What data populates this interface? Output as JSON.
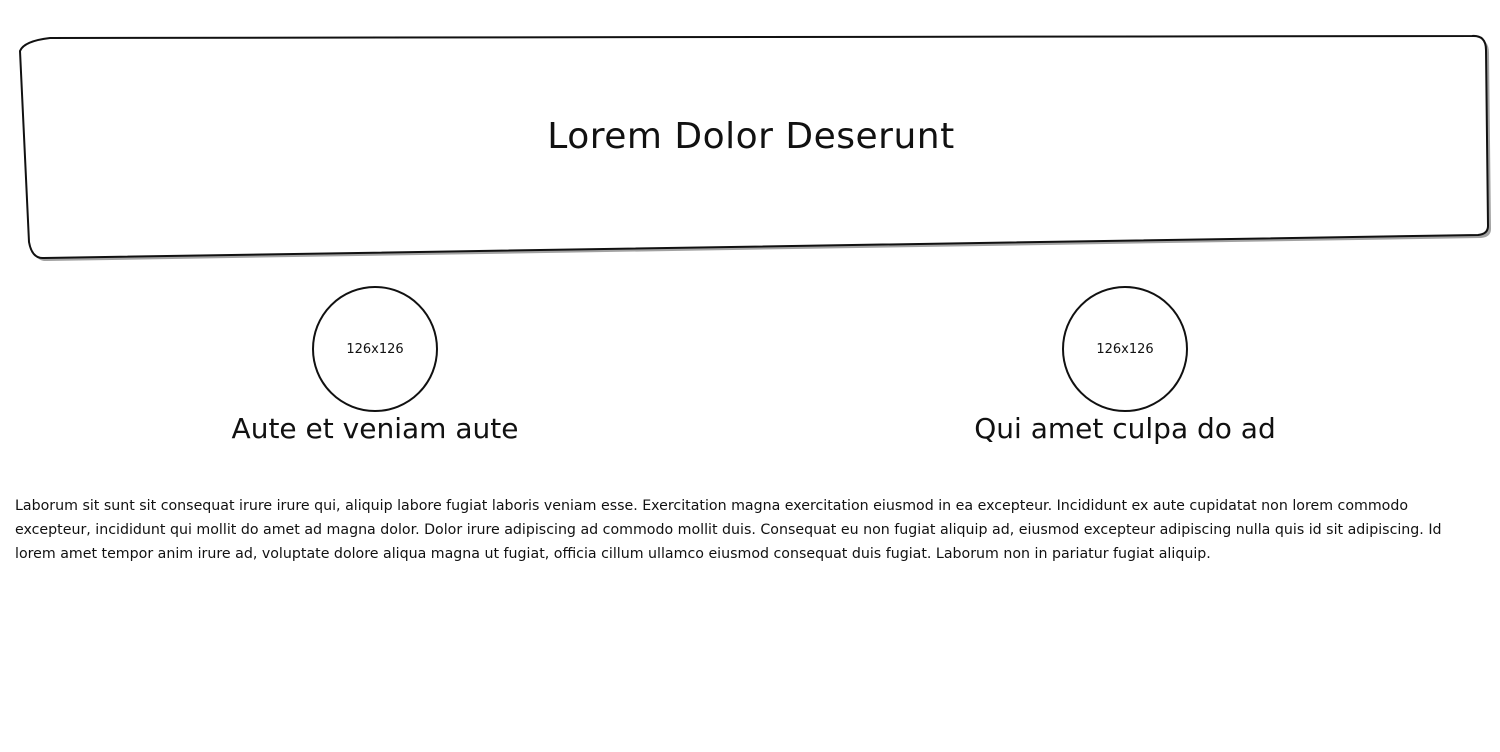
{
  "header": {
    "title": "Lorem Dolor Deserunt"
  },
  "features": [
    {
      "image_placeholder": "126x126",
      "title": "Aute et veniam aute"
    },
    {
      "image_placeholder": "126x126",
      "title": "Qui amet culpa do ad"
    }
  ],
  "body": {
    "paragraph": "Laborum sit sunt sit consequat irure irure qui, aliquip labore fugiat laboris veniam esse. Exercitation magna exercitation eiusmod in ea excepteur. Incididunt ex aute cupidatat non lorem commodo excepteur, incididunt qui mollit do amet ad magna dolor. Dolor irure adipiscing ad commodo mollit duis. Consequat eu non fugiat aliquip ad, eiusmod excepteur adipiscing nulla quis id sit adipiscing. Id lorem amet tempor anim irure ad, voluptate dolore aliqua magna ut fugiat, officia cillum ullamco eiusmod consequat duis fugiat. Laborum non in pariatur fugiat aliquip."
  }
}
